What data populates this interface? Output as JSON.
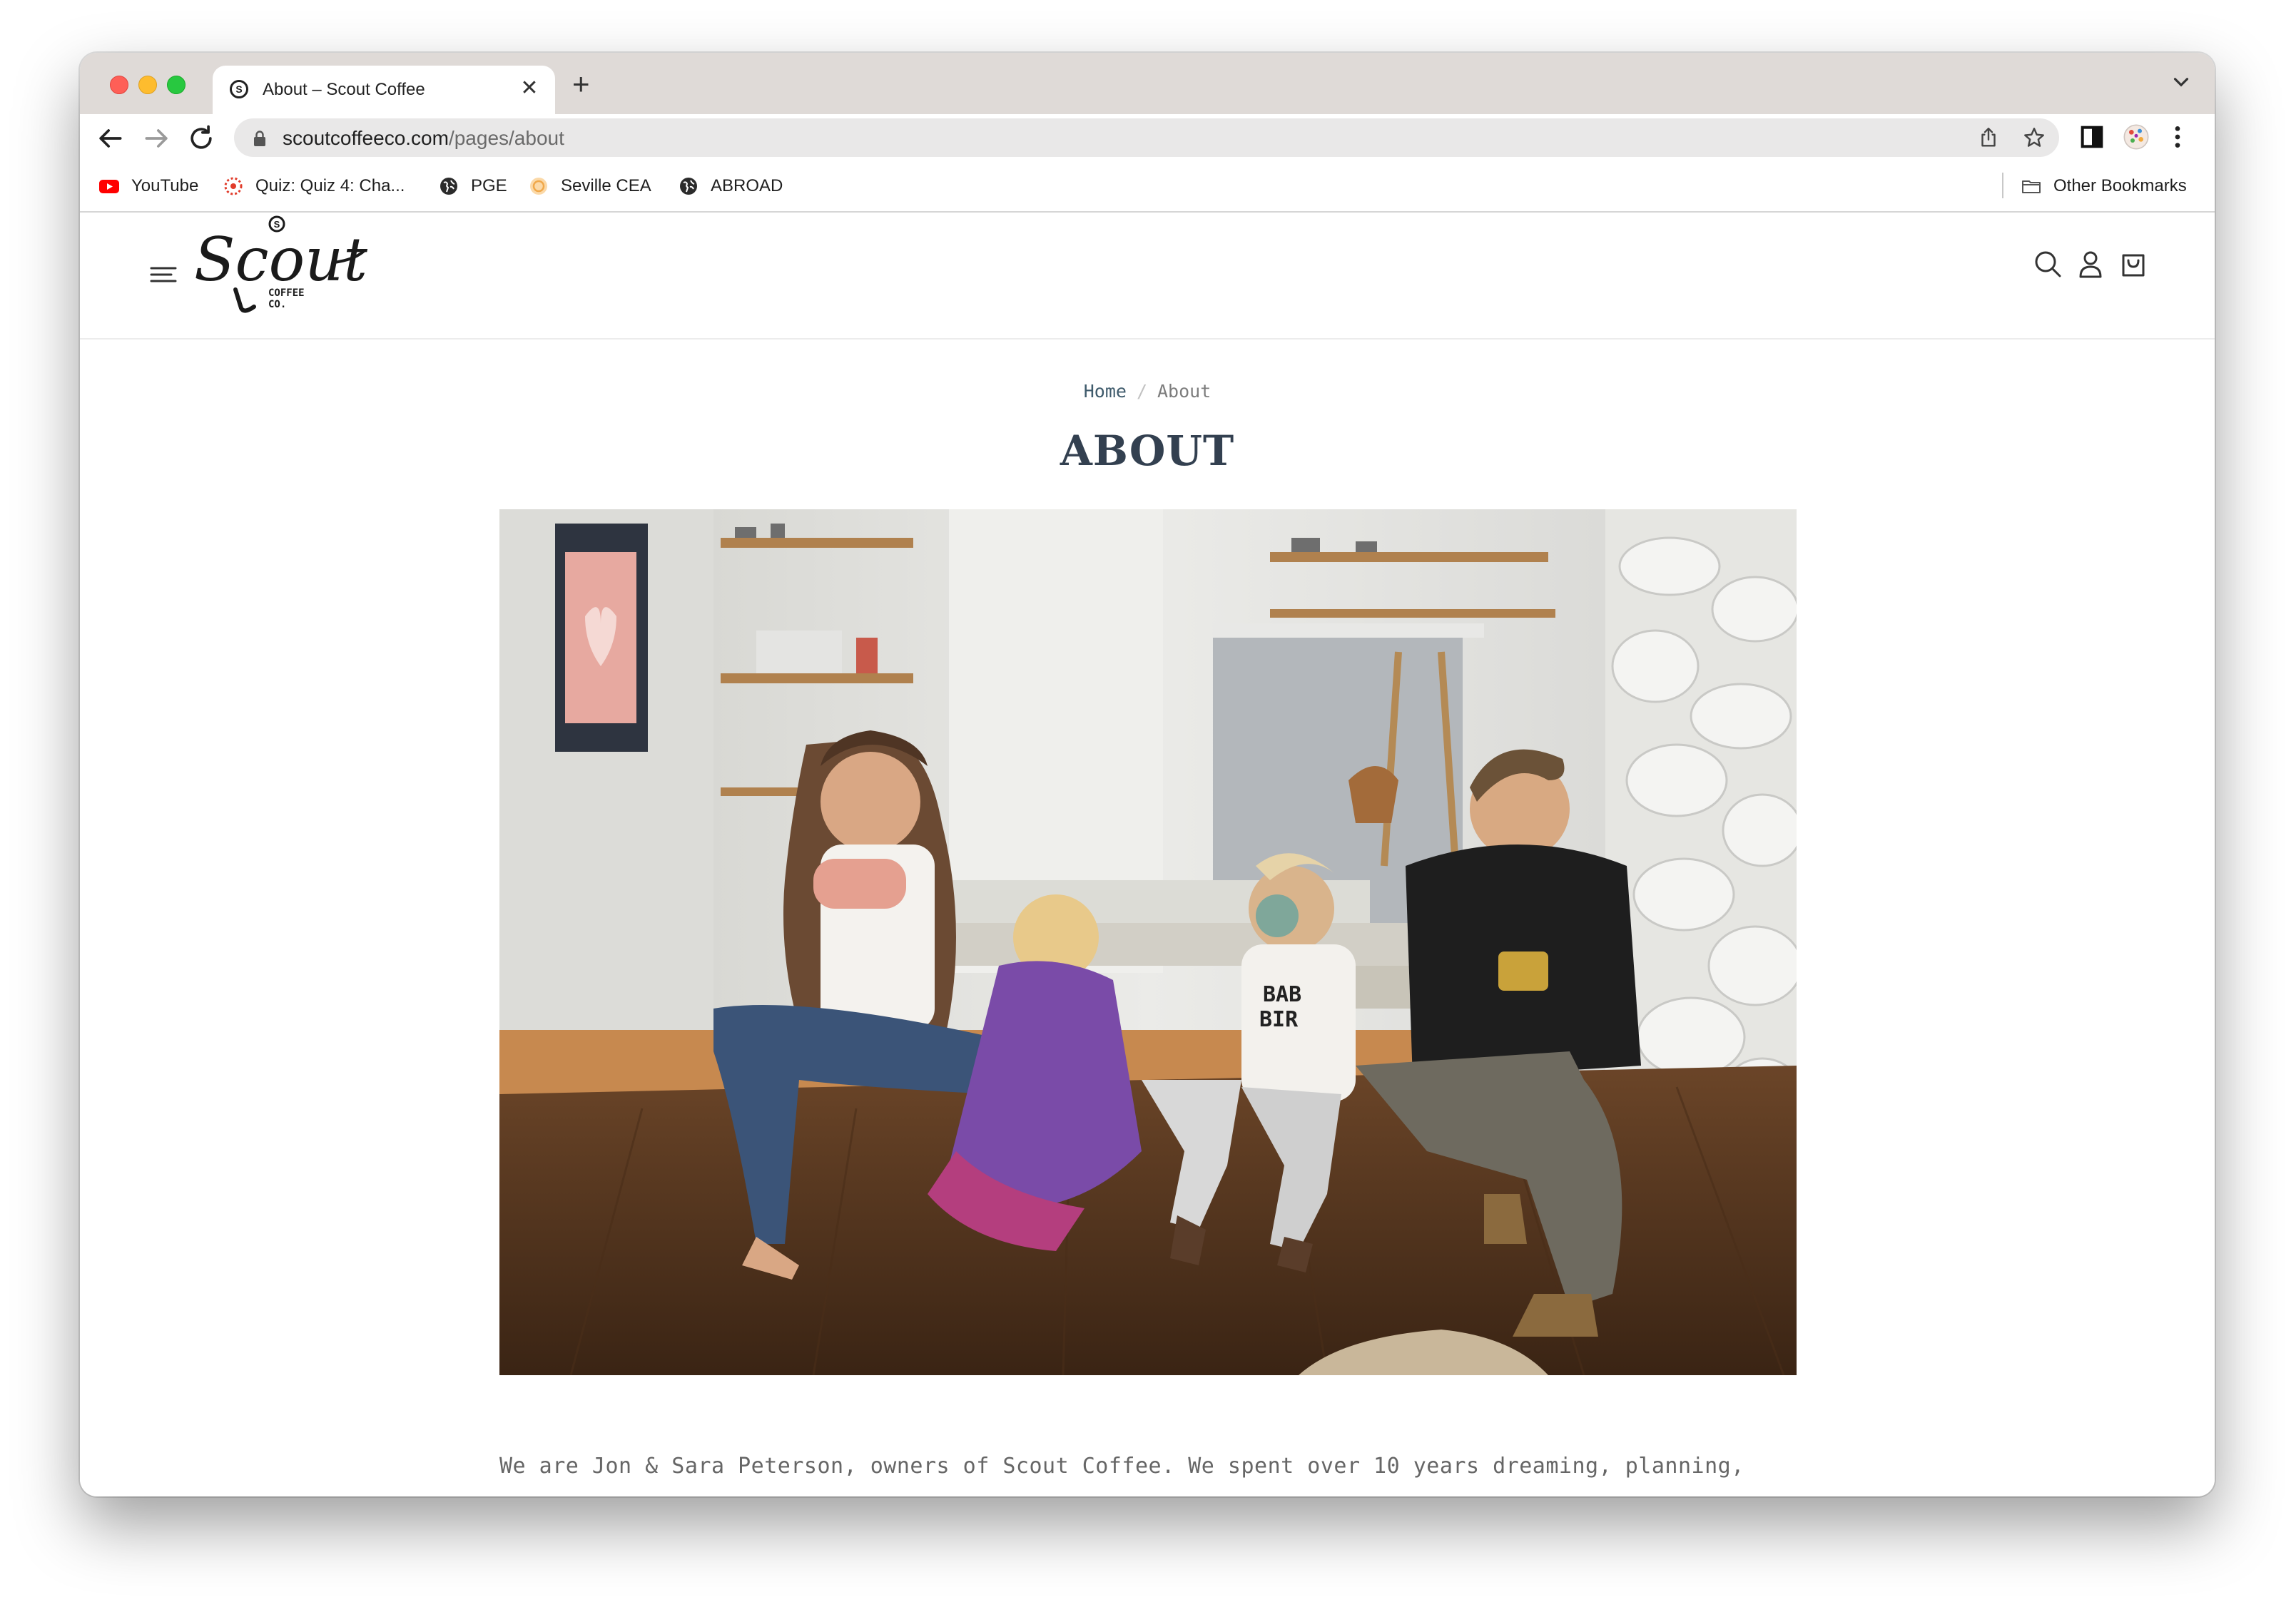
{
  "browser": {
    "tab_title": "About – Scout Coffee",
    "tab_favicon_letter": "S",
    "new_tab_symbol": "+",
    "close_symbol": "✕",
    "url_domain": "scoutcoffeeco.com",
    "url_path": "/pages/about"
  },
  "bookmarks": {
    "items": [
      {
        "label": "YouTube",
        "icon": "youtube-icon"
      },
      {
        "label": "Quiz: Quiz 4: Cha...",
        "icon": "canvas-icon"
      },
      {
        "label": "PGE",
        "icon": "globe-icon"
      },
      {
        "label": "Seville CEA",
        "icon": "cea-icon"
      },
      {
        "label": "ABROAD",
        "icon": "globe-icon"
      }
    ],
    "other_label": "Other Bookmarks"
  },
  "site": {
    "logo_text": "Scout",
    "logo_sub_1": "COFFEE",
    "logo_sub_2": "CO.",
    "logo_badge": "S"
  },
  "breadcrumb": {
    "home": "Home",
    "separator": "/",
    "current": "About"
  },
  "page": {
    "title": "ABOUT",
    "intro": "We are Jon & Sara Peterson, owners of Scout Coffee. We spent over 10 years dreaming, planning,"
  },
  "colors": {
    "title": "#334050",
    "breadcrumb_home": "#3f5b6c",
    "tabstrip": "#dfdad7"
  }
}
